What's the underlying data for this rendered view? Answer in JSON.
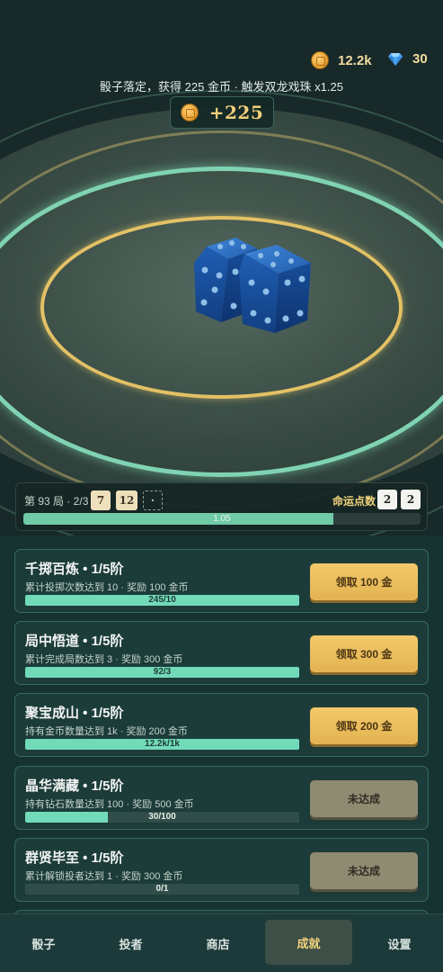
{
  "hud": {
    "coins": "12.2k",
    "gems": "30",
    "toast": "骰子落定，获得 225 金币 · 触发双龙戏珠 x1.25",
    "gain": "+225"
  },
  "round": {
    "label": "第 93 局 · 2/3",
    "chips": [
      "7",
      "12",
      "·"
    ],
    "fate_label": "命运点数",
    "fate_values": [
      "2",
      "2"
    ],
    "multiplier": "1.05",
    "progress": 0.78
  },
  "achievements": [
    {
      "title": "千掷百炼 • 1/5阶",
      "desc": "累计投掷次数达到 10 · 奖励 100 金币",
      "progress_text": "245/10",
      "progress": 1.0,
      "button": "领取 100 金",
      "state": "claim"
    },
    {
      "title": "局中悟道 • 1/5阶",
      "desc": "累计完成局数达到 3 · 奖励 300 金币",
      "progress_text": "92/3",
      "progress": 1.0,
      "button": "领取 300 金",
      "state": "claim"
    },
    {
      "title": "聚宝成山 • 1/5阶",
      "desc": "持有金币数量达到 1k · 奖励 200 金币",
      "progress_text": "12.2k/1k",
      "progress": 1.0,
      "button": "领取 200 金",
      "state": "claim"
    },
    {
      "title": "晶华满藏 • 1/5阶",
      "desc": "持有钻石数量达到 100 · 奖励 500 金币",
      "progress_text": "30/100",
      "progress": 0.3,
      "button": "未达成",
      "state": "locked"
    },
    {
      "title": "群贤毕至 • 1/5阶",
      "desc": "累计解锁投者达到 1 · 奖励 300 金币",
      "progress_text": "0/1",
      "progress": 0.0,
      "button": "未达成",
      "state": "locked"
    }
  ],
  "nav": {
    "tabs": [
      "骰子",
      "投者",
      "商店",
      "成就",
      "设置"
    ],
    "active": "成就"
  },
  "colors": {
    "accent_gold": "#f0d27c",
    "progress_teal": "#72dab8",
    "claim_button": "#f3c96a",
    "locked_button": "#8f8b72"
  }
}
